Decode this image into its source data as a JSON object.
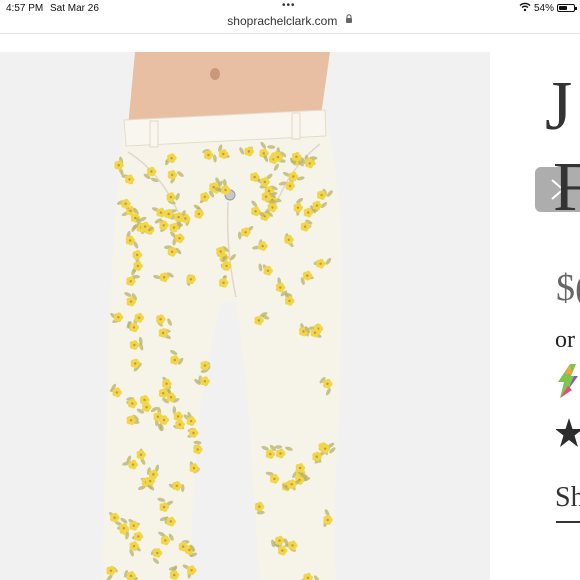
{
  "status_bar": {
    "time": "4:57 PM",
    "date": "Sat Mar 26",
    "battery_percent": "54%",
    "battery_level": 0.54
  },
  "browser": {
    "url": "shoprachelclark.com"
  },
  "product": {
    "title_line1_visible": "J",
    "title_line2_visible": "F",
    "price_visible": "$(",
    "payment_prefix": "or",
    "share_label_visible": "Sh"
  },
  "colors": {
    "jeans_base": "#f6f3e8",
    "flower_yellow": "#f1d54a",
    "leaf_olive": "#b6b26a",
    "arrow_button": "#a9a9a9"
  },
  "icons": [
    "wifi-icon",
    "battery-icon",
    "lock-icon",
    "next-arrow-icon",
    "afterpay-logo",
    "star-icon"
  ]
}
